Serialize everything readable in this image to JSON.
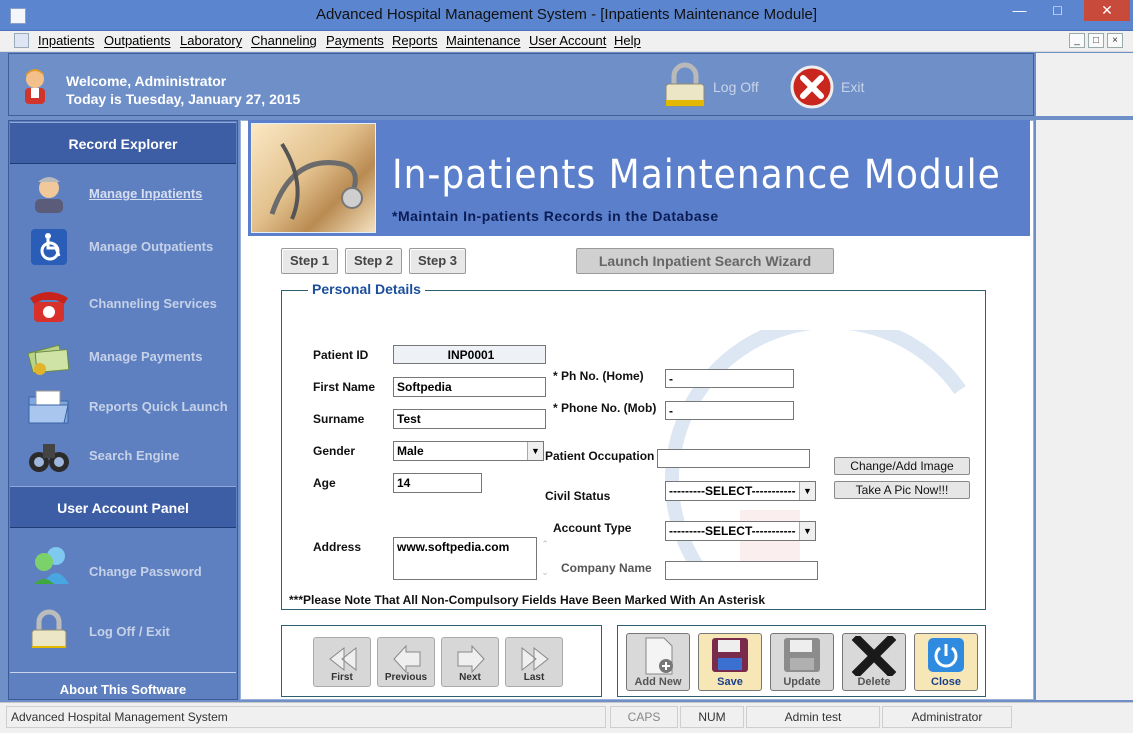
{
  "window": {
    "title": "Advanced Hospital Management System - [Inpatients Maintenance Module]"
  },
  "menu": [
    "Inpatients",
    "Outpatients",
    "Laboratory",
    "Channeling",
    "Payments",
    "Reports",
    "Maintenance",
    "User Account",
    "Help"
  ],
  "header": {
    "welcome": "Welcome, Administrator",
    "date": "Today is Tuesday, January 27, 2015",
    "logoff": "Log Off",
    "exit": "Exit"
  },
  "sidebar": {
    "record_explorer": "Record Explorer",
    "items": [
      "Manage Inpatients",
      "Manage Outpatients",
      "Channeling Services",
      "Manage Payments",
      "Reports Quick Launch",
      "Search Engine"
    ],
    "user_panel": "User Account Panel",
    "user_items": [
      "Change Password",
      "Log Off / Exit"
    ],
    "about": "About This Software"
  },
  "banner": {
    "title": "In-patients Maintenance Module",
    "subtitle": "*Maintain In-patients Records in the Database"
  },
  "steps": [
    "Step 1",
    "Step 2",
    "Step 3"
  ],
  "wizard": "Launch Inpatient Search Wizard",
  "form": {
    "group_title": "Personal Details",
    "patient_id_label": "Patient ID",
    "patient_id": "INP0001",
    "first_name_label": "First Name",
    "first_name": "Softpedia",
    "surname_label": "Surname",
    "surname": "Test",
    "gender_label": "Gender",
    "gender": "Male",
    "age_label": "Age",
    "age": "14",
    "address_label": "Address",
    "address": "www.softpedia.com",
    "ph_home_label": "*  Ph No. (Home)",
    "ph_home": "-",
    "ph_mob_label": "* Phone No. (Mob)",
    "ph_mob": "-",
    "occupation_label": "Patient Occupation",
    "occupation": "",
    "civil_label": "Civil Status",
    "civil": "---------SELECT-----------",
    "account_label": "Account Type",
    "account": "---------SELECT-----------",
    "company_label": "Company Name",
    "company": "",
    "change_image": "Change/Add Image",
    "take_pic": "Take A Pic Now!!!",
    "note": "***Please Note That All Non-Compulsory Fields Have Been Marked With An Asterisk"
  },
  "nav": [
    "First",
    "Previous",
    "Next",
    "Last"
  ],
  "actions": [
    "Add New",
    "Save",
    "Update",
    "Delete",
    "Close"
  ],
  "status": {
    "app": "Advanced Hospital Management System",
    "caps": "CAPS",
    "num": "NUM",
    "user": "Admin test",
    "role": "Administrator"
  }
}
